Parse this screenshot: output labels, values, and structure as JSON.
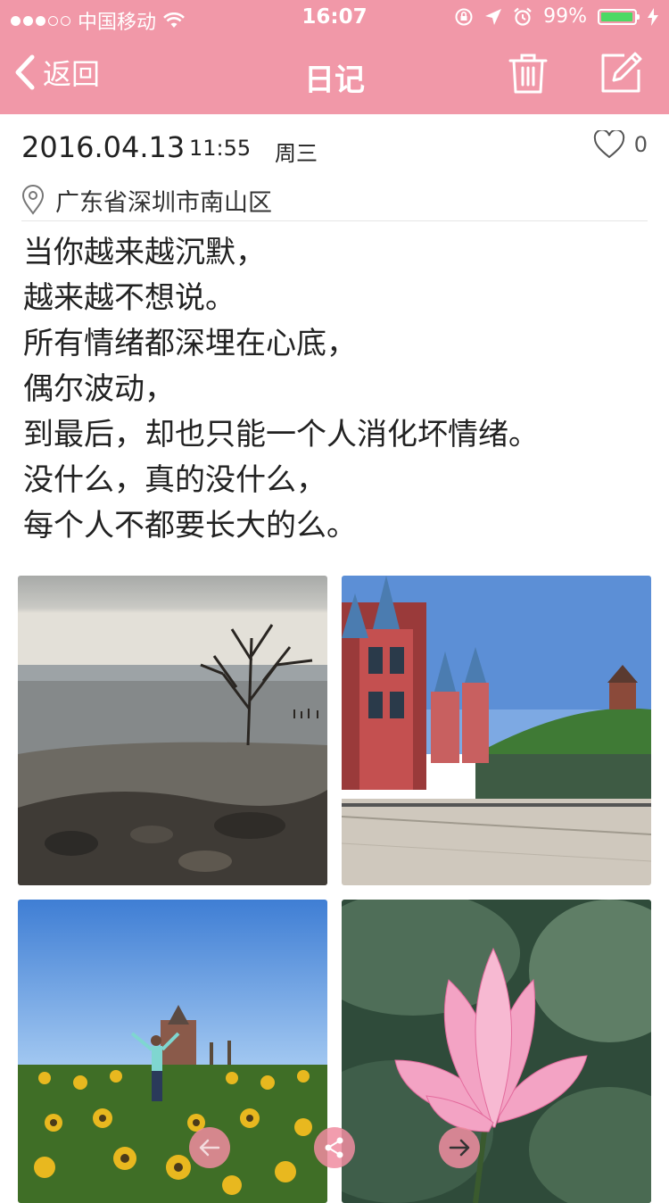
{
  "status_bar": {
    "carrier": "中国移动",
    "time": "16:07",
    "battery_percent": "99%",
    "battery_level": 0.99,
    "signal_bars": 3,
    "signal_total": 5
  },
  "navbar": {
    "back_label": "返回",
    "title": "日记",
    "actions": [
      "trash-icon",
      "edit-icon"
    ]
  },
  "entry": {
    "date": "2016.04.13",
    "time": "11:55",
    "weekday": "周三",
    "like_count": "0",
    "location": "广东省深圳市南山区",
    "lines": [
      "当你越来越沉默，",
      "越来越不想说。",
      "所有情绪都深埋在心底，",
      "偶尔波动，",
      "到最后，却也只能一个人消化坏情绪。",
      "没什么，真的没什么，",
      "每个人不都要长大的么。"
    ]
  },
  "photos": [
    "beach-tree-photo",
    "castle-lake-photo",
    "sunflower-field-photo",
    "lotus-flower-photo"
  ],
  "bottom_actions": [
    "prev-arrow-icon",
    "share-icon",
    "next-arrow-icon"
  ],
  "colors": {
    "accent": "#f198a8",
    "battery": "#4cd964"
  }
}
